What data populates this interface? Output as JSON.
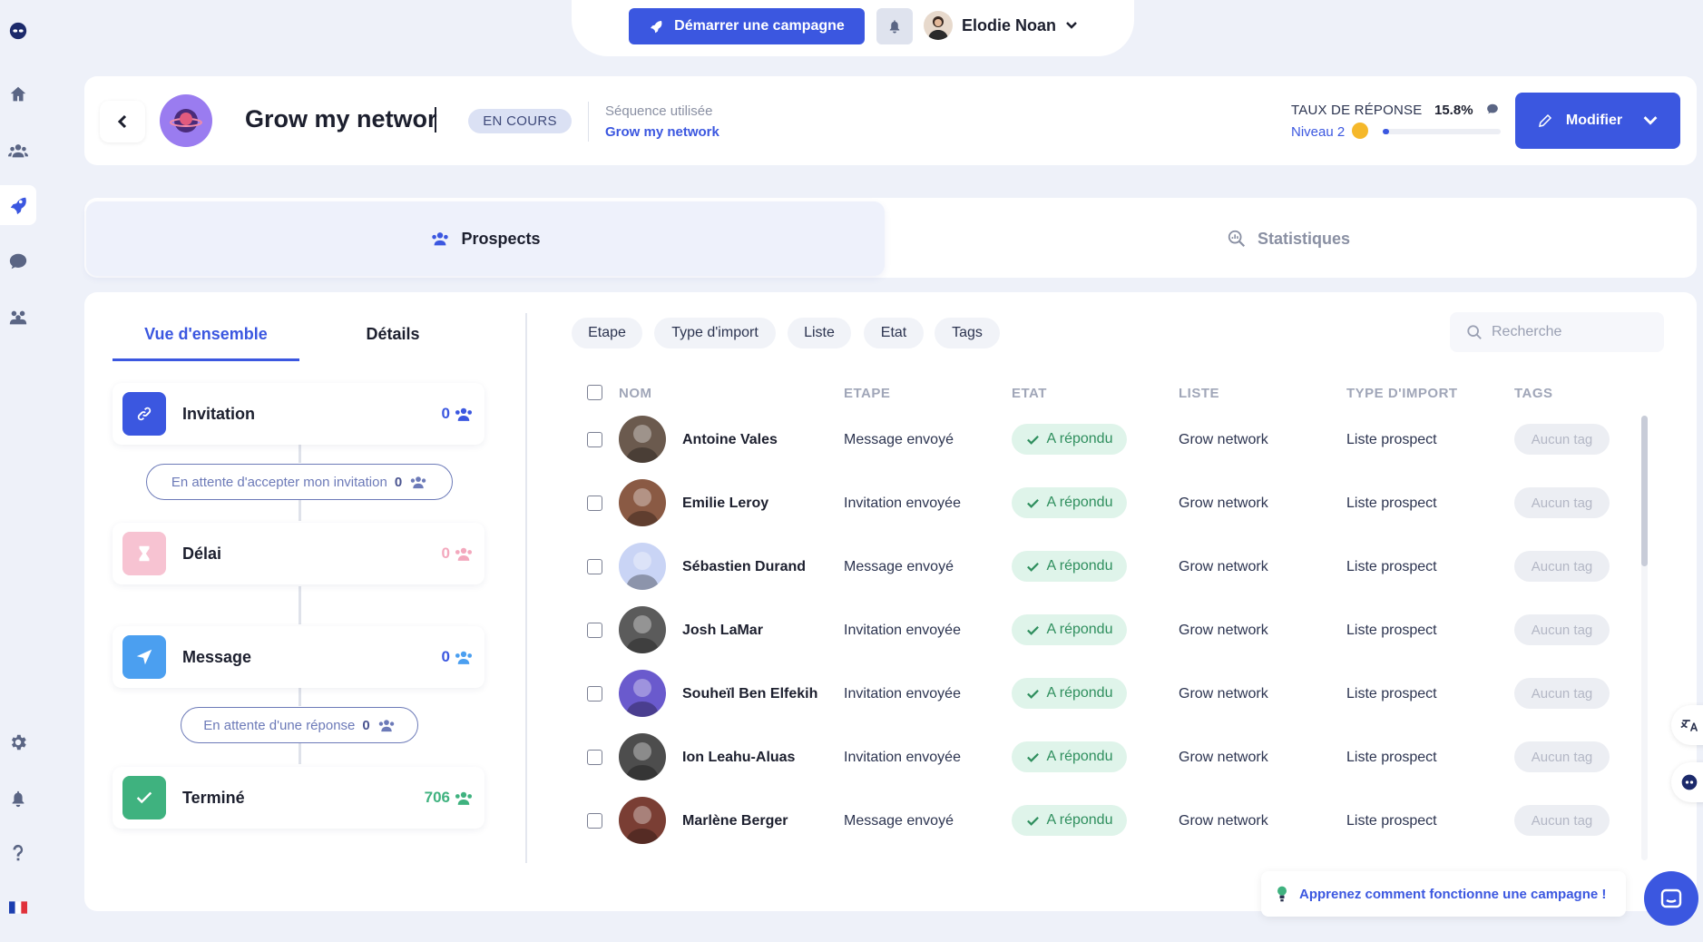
{
  "app": {
    "start_campaign_label": "Démarrer une campagne",
    "user_name": "Elodie Noan",
    "language_flag": "fr-flag-icon"
  },
  "header": {
    "campaign_title": "Grow my network",
    "status": "EN COURS",
    "sequence_label": "Séquence utilisée",
    "sequence_name": "Grow my network",
    "response_rate_label": "TAUX DE RÉPONSE",
    "response_rate_value": "15.8%",
    "level_label": "Niveau 2",
    "level_progress": 0.05,
    "modify_label": "Modifier"
  },
  "tabs": [
    {
      "label": "Prospects",
      "active": true
    },
    {
      "label": "Statistiques",
      "active": false
    }
  ],
  "subtabs": [
    {
      "label": "Vue d'ensemble",
      "active": true
    },
    {
      "label": "Détails",
      "active": false
    }
  ],
  "steps": [
    {
      "name": "Invitation",
      "count": "0",
      "color": "#3b57e0",
      "count_color": "#3b57e0"
    },
    {
      "name": "Délai",
      "count": "0",
      "color": "#f7b6c8",
      "count_color": "#f3a8bd"
    },
    {
      "name": "Message",
      "count": "0",
      "color": "#4b9ff0",
      "count_color": "#3b57e0"
    },
    {
      "name": "Terminé",
      "count": "706",
      "color": "#3fb27f",
      "count_color": "#3fb27f"
    }
  ],
  "waits": [
    {
      "label": "En attente d'accepter mon invitation",
      "count": "0"
    },
    {
      "label": "En attente d'une réponse",
      "count": "0"
    }
  ],
  "filters": [
    "Etape",
    "Type d'import",
    "Liste",
    "Etat",
    "Tags"
  ],
  "search": {
    "placeholder": "Recherche"
  },
  "table": {
    "columns": [
      "NOM",
      "ETAPE",
      "ETAT",
      "LISTE",
      "TYPE D'IMPORT",
      "TAGS"
    ],
    "rows": [
      {
        "name": "Antoine Vales",
        "step": "Message envoyé",
        "state": "A répondu",
        "list": "Grow network",
        "import_type": "Liste prospect",
        "tags": "Aucun tag"
      },
      {
        "name": "Emilie Leroy",
        "step": "Invitation envoyée",
        "state": "A répondu",
        "list": "Grow network",
        "import_type": "Liste prospect",
        "tags": "Aucun tag"
      },
      {
        "name": "Sébastien Durand",
        "step": "Message envoyé",
        "state": "A répondu",
        "list": "Grow network",
        "import_type": "Liste prospect",
        "tags": "Aucun tag"
      },
      {
        "name": "Josh LaMar",
        "step": "Invitation envoyée",
        "state": "A répondu",
        "list": "Grow network",
        "import_type": "Liste prospect",
        "tags": "Aucun tag"
      },
      {
        "name": "Souheïl Ben Elfekih",
        "step": "Invitation envoyée",
        "state": "A répondu",
        "list": "Grow network",
        "import_type": "Liste prospect",
        "tags": "Aucun tag"
      },
      {
        "name": "Ion Leahu-Aluas",
        "step": "Invitation envoyée",
        "state": "A répondu",
        "list": "Grow network",
        "import_type": "Liste prospect",
        "tags": "Aucun tag"
      },
      {
        "name": "Marlène Berger",
        "step": "Message envoyé",
        "state": "A répondu",
        "list": "Grow network",
        "import_type": "Liste prospect",
        "tags": "Aucun tag"
      }
    ]
  },
  "help": {
    "label": "Apprenez comment fonctionne une campagne !"
  },
  "colors": {
    "accent": "#3b57e0",
    "success": "#2f8f5e",
    "background": "#eef1f9"
  }
}
